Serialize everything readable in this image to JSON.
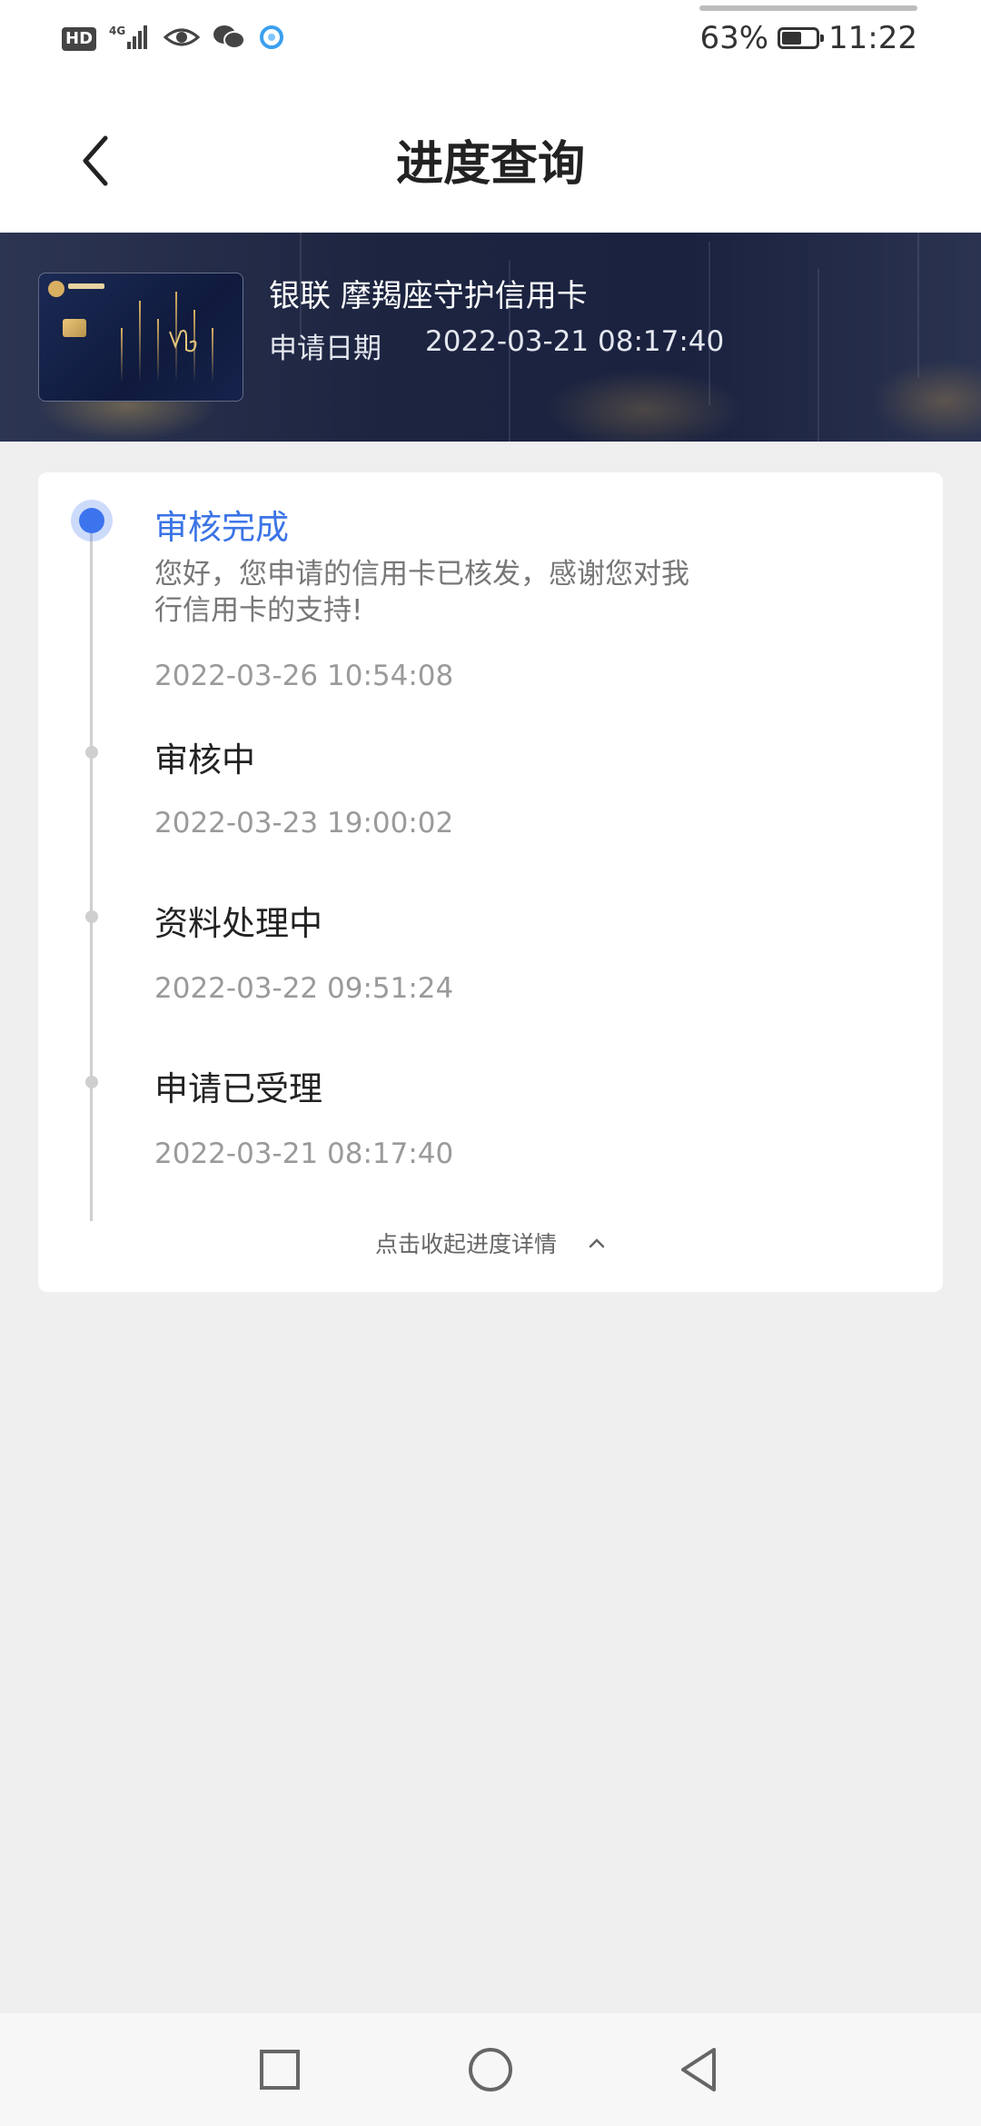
{
  "status_bar": {
    "hd": "HD",
    "network": "4G",
    "battery_percent": "63%",
    "battery_level": 0.63,
    "time": "11:22",
    "icons": [
      "signal-icon",
      "eye-icon",
      "wechat-icon",
      "browser-icon"
    ]
  },
  "header": {
    "title": "进度查询",
    "back_icon": "chevron-left-icon"
  },
  "card": {
    "name": "银联 摩羯座守护信用卡",
    "apply_label": "申请日期",
    "apply_date": "2022-03-21 08:17:40"
  },
  "steps": [
    {
      "title": "审核完成",
      "desc": "您好，您申请的信用卡已核发，感谢您对我行信用卡的支持!",
      "time": "2022-03-26 10:54:08",
      "active": true
    },
    {
      "title": "审核中",
      "time": "2022-03-23 19:00:02",
      "active": false
    },
    {
      "title": "资料处理中",
      "time": "2022-03-22 09:51:24",
      "active": false
    },
    {
      "title": "申请已受理",
      "time": "2022-03-21 08:17:40",
      "active": false
    }
  ],
  "collapse_label": "点击收起进度详情",
  "colors": {
    "accent": "#3b74e6",
    "banner": "#1c2440"
  },
  "nav": {
    "icons": [
      "recent-apps-icon",
      "home-icon",
      "back-icon"
    ]
  }
}
